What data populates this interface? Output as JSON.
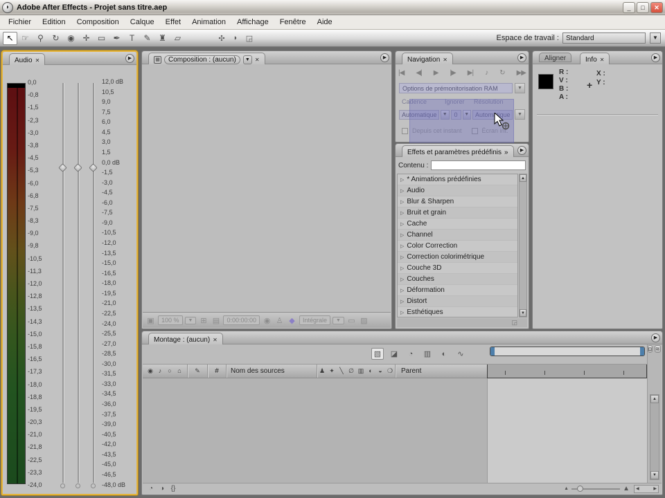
{
  "window": {
    "title": "Adobe After Effects - Projet sans titre.aep",
    "minimize": "_",
    "maximize": "□",
    "close": "✕"
  },
  "menus": [
    "Fichier",
    "Edition",
    "Composition",
    "Calque",
    "Effet",
    "Animation",
    "Affichage",
    "Fenêtre",
    "Aide"
  ],
  "toolbar": {
    "tools": [
      {
        "name": "selection-tool",
        "glyph": "↖",
        "active": "true"
      },
      {
        "name": "hand-tool",
        "glyph": "☞",
        "active": "false"
      },
      {
        "name": "zoom-tool",
        "glyph": "⚲",
        "active": "false"
      },
      {
        "name": "rotation-tool",
        "glyph": "↻",
        "active": "false"
      },
      {
        "name": "orbit-camera-tool",
        "glyph": "◉",
        "active": "false"
      },
      {
        "name": "pan-behind-tool",
        "glyph": "✛",
        "active": "false"
      },
      {
        "name": "rectangle-mask-tool",
        "glyph": "▭",
        "active": "false"
      },
      {
        "name": "pen-tool",
        "glyph": "✒",
        "active": "false"
      },
      {
        "name": "type-tool",
        "glyph": "T",
        "active": "false"
      },
      {
        "name": "brush-tool",
        "glyph": "✎",
        "active": "false"
      },
      {
        "name": "clone-stamp-tool",
        "glyph": "♜",
        "active": "false"
      },
      {
        "name": "eraser-tool",
        "glyph": "▱",
        "active": "false"
      }
    ],
    "extra_icons": [
      {
        "name": "workspace-flower-icon",
        "glyph": "✣"
      },
      {
        "name": "pin-icon",
        "glyph": "◗"
      },
      {
        "name": "expand-icon",
        "glyph": "◲"
      }
    ],
    "workspace_label": "Espace de travail :",
    "workspace_value": "Standard"
  },
  "audio": {
    "tab": "Audio",
    "left_scale": [
      "0,0",
      "-0,8",
      "-1,5",
      "-2,3",
      "-3,0",
      "-3,8",
      "-4,5",
      "-5,3",
      "-6,0",
      "-6,8",
      "-7,5",
      "-8,3",
      "-9,0",
      "-9,8",
      "-10,5",
      "-11,3",
      "-12,0",
      "-12,8",
      "-13,5",
      "-14,3",
      "-15,0",
      "-15,8",
      "-16,5",
      "-17,3",
      "-18,0",
      "-18,8",
      "-19,5",
      "-20,3",
      "-21,0",
      "-21,8",
      "-22,5",
      "-23,3",
      "-24,0"
    ],
    "right_scale": [
      "12,0 dB",
      "10,5",
      "9,0",
      "7,5",
      "6,0",
      "4,5",
      "3,0",
      "1,5",
      "0,0 dB",
      "-1,5",
      "-3,0",
      "-4,5",
      "-6,0",
      "-7,5",
      "-9,0",
      "-10,5",
      "-12,0",
      "-13,5",
      "-15,0",
      "-16,5",
      "-18,0",
      "-19,5",
      "-21,0",
      "-22,5",
      "-24,0",
      "-25,5",
      "-27,0",
      "-28,5",
      "-30,0",
      "-31,5",
      "-33,0",
      "-34,5",
      "-36,0",
      "-37,5",
      "-39,0",
      "-40,5",
      "-42,0",
      "-43,5",
      "-45,0",
      "-46,5",
      "-48,0 dB"
    ]
  },
  "composition": {
    "tab": "Composition : (aucun)",
    "zoom_value": "100 %",
    "timecode": "0:00:00:00",
    "resolution_value": "Intégrale"
  },
  "navigation": {
    "tab": "Navigation",
    "playback_buttons": [
      {
        "name": "first-frame-button",
        "glyph": "|◀"
      },
      {
        "name": "previous-frame-button",
        "glyph": "◀|"
      },
      {
        "name": "play-button",
        "glyph": "▶"
      },
      {
        "name": "next-frame-button",
        "glyph": "|▶"
      },
      {
        "name": "last-frame-button",
        "glyph": "▶|"
      },
      {
        "name": "audio-toggle-button",
        "glyph": "♪"
      },
      {
        "name": "loop-button",
        "glyph": "↻"
      },
      {
        "name": "ram-preview-button",
        "glyph": "▶▶"
      }
    ],
    "ram_options_title": "Options de prémonitorisation RAM",
    "col_labels": [
      "Cadence",
      "Ignorer",
      "Résolution"
    ],
    "values": [
      "Automatique",
      "0",
      "Automatique"
    ],
    "from_current_label": "Depuis cet instant",
    "full_screen_label": "Écran int."
  },
  "effects": {
    "tab": "Effets et paramètres prédéfinis",
    "tab_chevron": "»",
    "contents_label": "Contenu :",
    "categories": [
      "* Animations prédéfinies",
      "Audio",
      "Blur & Sharpen",
      "Bruit et grain",
      "Cache",
      "Channel",
      "Color Correction",
      "Correction colorimétrique",
      "Couche 3D",
      "Couches",
      "Déformation",
      "Distort",
      "Esthétiques"
    ]
  },
  "info": {
    "tab_aligner": "Aligner",
    "tab_info": "Info",
    "rgba_labels": [
      "R :",
      "V :",
      "B :",
      "A :"
    ],
    "xy_labels": [
      "X :",
      "Y :"
    ],
    "crosshair": "+"
  },
  "timeline": {
    "tab": "Montage : (aucun)",
    "columns": {
      "hash": "#",
      "source_name": "Nom des sources",
      "parent": "Parent"
    },
    "header_av_icons": [
      {
        "name": "video-visibility-icon",
        "glyph": "◉"
      },
      {
        "name": "audio-icon",
        "glyph": "♪"
      },
      {
        "name": "solo-icon",
        "glyph": "○"
      },
      {
        "name": "lock-icon",
        "glyph": "⌂"
      }
    ],
    "header_label_icon": "✎",
    "switch_icons": [
      {
        "name": "shy-icon",
        "glyph": "♟"
      },
      {
        "name": "collapse-icon",
        "glyph": "✦"
      },
      {
        "name": "quality-icon",
        "glyph": "╲"
      },
      {
        "name": "effects-icon",
        "glyph": "∅"
      },
      {
        "name": "frame-blend-icon",
        "glyph": "▥"
      },
      {
        "name": "motion-blur-icon",
        "glyph": "◐"
      },
      {
        "name": "adjustment-layer-icon",
        "glyph": "◒"
      },
      {
        "name": "3d-layer-icon",
        "glyph": "❍"
      }
    ],
    "toolbar_icons": [
      {
        "name": "comp-mini-flowchart-button",
        "glyph": "▧",
        "pressed": "true"
      },
      {
        "name": "live-update-button",
        "glyph": "◪",
        "pressed": "false"
      },
      {
        "name": "draft-3d-button",
        "glyph": "◔",
        "pressed": "false"
      },
      {
        "name": "frame-blending-button",
        "glyph": "▥",
        "pressed": "false"
      },
      {
        "name": "motion-blur-button",
        "glyph": "◐",
        "pressed": "false"
      },
      {
        "name": "graph-editor-button",
        "glyph": "∿",
        "pressed": "false"
      }
    ],
    "bottom_icons": [
      {
        "name": "expand-layer-switches-button",
        "glyph": "◔"
      },
      {
        "name": "expand-transfer-modes-button",
        "glyph": "◑"
      },
      {
        "name": "expand-inout-button",
        "glyph": "{}"
      }
    ]
  }
}
